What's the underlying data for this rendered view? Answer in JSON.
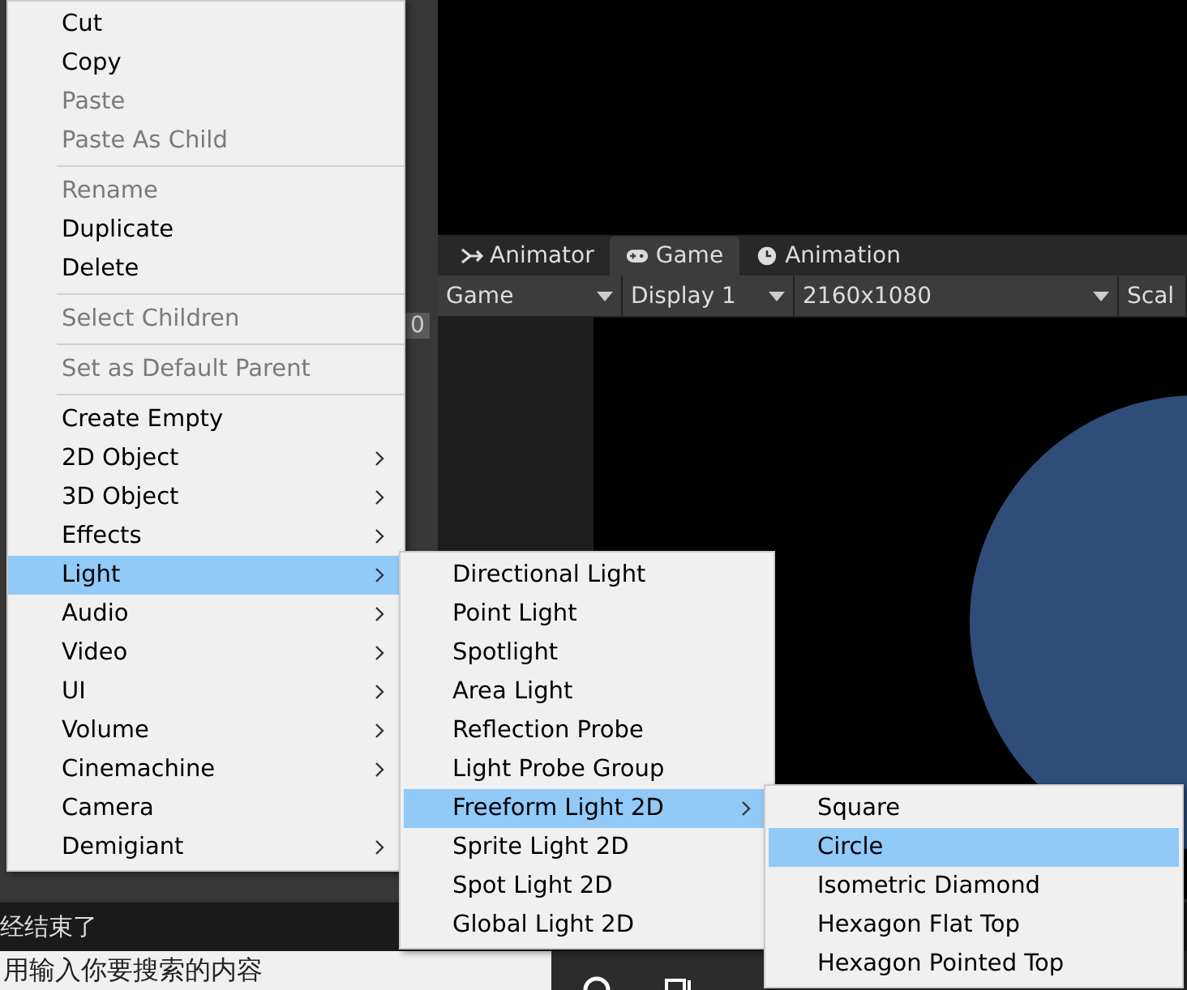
{
  "editor_tabs": [
    {
      "label": "Animator",
      "selected": false
    },
    {
      "label": "Game",
      "selected": true
    },
    {
      "label": "Animation",
      "selected": false
    }
  ],
  "toolbar": {
    "dropdowns": [
      "Game",
      "Display 1",
      "2160x1080"
    ],
    "scale_label": "Scal"
  },
  "side_value": "0",
  "context_menu": [
    {
      "kind": "item",
      "label": "Cut",
      "disabled": false,
      "submenu": false,
      "selected": false
    },
    {
      "kind": "item",
      "label": "Copy",
      "disabled": false,
      "submenu": false,
      "selected": false
    },
    {
      "kind": "item",
      "label": "Paste",
      "disabled": true,
      "submenu": false,
      "selected": false
    },
    {
      "kind": "item",
      "label": "Paste As Child",
      "disabled": true,
      "submenu": false,
      "selected": false
    },
    {
      "kind": "separator"
    },
    {
      "kind": "item",
      "label": "Rename",
      "disabled": true,
      "submenu": false,
      "selected": false
    },
    {
      "kind": "item",
      "label": "Duplicate",
      "disabled": false,
      "submenu": false,
      "selected": false
    },
    {
      "kind": "item",
      "label": "Delete",
      "disabled": false,
      "submenu": false,
      "selected": false
    },
    {
      "kind": "separator"
    },
    {
      "kind": "item",
      "label": "Select Children",
      "disabled": true,
      "submenu": false,
      "selected": false
    },
    {
      "kind": "separator"
    },
    {
      "kind": "item",
      "label": "Set as Default Parent",
      "disabled": true,
      "submenu": false,
      "selected": false
    },
    {
      "kind": "separator"
    },
    {
      "kind": "item",
      "label": "Create Empty",
      "disabled": false,
      "submenu": false,
      "selected": false
    },
    {
      "kind": "item",
      "label": "2D Object",
      "disabled": false,
      "submenu": true,
      "selected": false
    },
    {
      "kind": "item",
      "label": "3D Object",
      "disabled": false,
      "submenu": true,
      "selected": false
    },
    {
      "kind": "item",
      "label": "Effects",
      "disabled": false,
      "submenu": true,
      "selected": false
    },
    {
      "kind": "item",
      "label": "Light",
      "disabled": false,
      "submenu": true,
      "selected": true
    },
    {
      "kind": "item",
      "label": "Audio",
      "disabled": false,
      "submenu": true,
      "selected": false
    },
    {
      "kind": "item",
      "label": "Video",
      "disabled": false,
      "submenu": true,
      "selected": false
    },
    {
      "kind": "item",
      "label": "UI",
      "disabled": false,
      "submenu": true,
      "selected": false
    },
    {
      "kind": "item",
      "label": "Volume",
      "disabled": false,
      "submenu": true,
      "selected": false
    },
    {
      "kind": "item",
      "label": "Cinemachine",
      "disabled": false,
      "submenu": true,
      "selected": false
    },
    {
      "kind": "item",
      "label": "Camera",
      "disabled": false,
      "submenu": false,
      "selected": false
    },
    {
      "kind": "item",
      "label": "Demigiant",
      "disabled": false,
      "submenu": true,
      "selected": false
    }
  ],
  "light_submenu": [
    {
      "label": "Directional Light",
      "submenu": false,
      "selected": false
    },
    {
      "label": "Point Light",
      "submenu": false,
      "selected": false
    },
    {
      "label": "Spotlight",
      "submenu": false,
      "selected": false
    },
    {
      "label": "Area Light",
      "submenu": false,
      "selected": false
    },
    {
      "label": "Reflection Probe",
      "submenu": false,
      "selected": false
    },
    {
      "label": "Light Probe Group",
      "submenu": false,
      "selected": false
    },
    {
      "label": "Freeform Light 2D",
      "submenu": true,
      "selected": true
    },
    {
      "label": "Sprite Light 2D",
      "submenu": false,
      "selected": false
    },
    {
      "label": "Spot Light 2D",
      "submenu": false,
      "selected": false
    },
    {
      "label": "Global Light 2D",
      "submenu": false,
      "selected": false
    }
  ],
  "freeform_submenu": [
    {
      "label": "Square",
      "selected": false
    },
    {
      "label": "Circle",
      "selected": true
    },
    {
      "label": "Isometric Diamond",
      "selected": false
    },
    {
      "label": "Hexagon Flat Top",
      "selected": false
    },
    {
      "label": "Hexagon Pointed Top",
      "selected": false
    }
  ],
  "status_text": "经结束了",
  "search_text": "用输入你要搜索的内容"
}
